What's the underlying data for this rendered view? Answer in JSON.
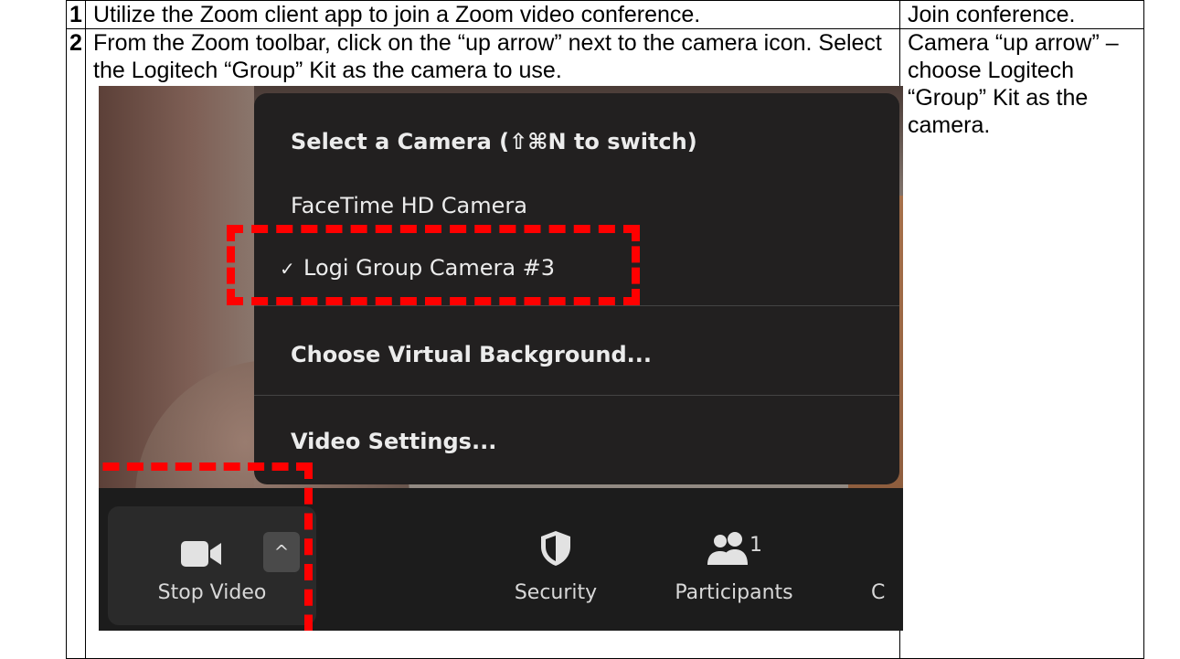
{
  "steps": [
    {
      "number": "1",
      "description": "Utilize the Zoom client app to join a Zoom video conference.",
      "summary": "Join conference."
    },
    {
      "number": "2",
      "description": "From the Zoom toolbar, click on the “up arrow” next to the camera icon.  Select the Logitech “Group” Kit as the camera to use.",
      "summary": "Camera “up arrow” – choose Logitech “Group” Kit as the camera."
    }
  ],
  "screenshot": {
    "menu": {
      "title": "Select a Camera (⇧⌘N to switch)",
      "items": [
        {
          "label": "FaceTime HD Camera",
          "checked": false
        },
        {
          "label": "Logi Group Camera #3",
          "checked": true,
          "check_glyph": "✓"
        },
        {
          "label": "Choose Virtual Background..."
        },
        {
          "label": "Video Settings..."
        }
      ]
    },
    "toolbar": {
      "stop_video": "Stop Video",
      "arrow": "^",
      "security": "Security",
      "participants": "Participants",
      "participants_count": "1",
      "chat_partial": "C"
    },
    "colors": {
      "highlight": "#ff0000",
      "menu_bg": "#222020",
      "toolbar_bg": "#1c1c1c"
    }
  }
}
